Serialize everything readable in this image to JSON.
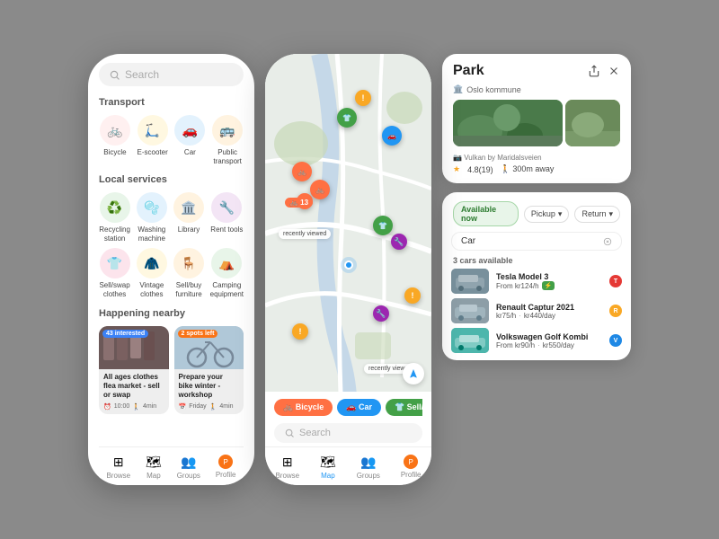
{
  "left_phone": {
    "search_placeholder": "Search",
    "transport_title": "Transport",
    "transport_items": [
      {
        "label": "Bicycle",
        "icon": "🚲",
        "bg": "#fff0f0",
        "color": "#e53935"
      },
      {
        "label": "E-scooter",
        "icon": "🛴",
        "bg": "#fff8e1",
        "color": "#f9a825"
      },
      {
        "label": "Car",
        "icon": "🚗",
        "bg": "#e3f2fd",
        "color": "#1e88e5"
      },
      {
        "label": "Public transport",
        "icon": "🚌",
        "bg": "#fff3e0",
        "color": "#ef6c00"
      }
    ],
    "services_title": "Local services",
    "service_items": [
      {
        "label": "Recycling station",
        "icon": "♻️",
        "bg": "#e8f5e9",
        "color": "#43a047"
      },
      {
        "label": "Washing machine",
        "icon": "🫧",
        "bg": "#e3f2fd",
        "color": "#1e88e5"
      },
      {
        "label": "Library",
        "icon": "🏛️",
        "bg": "#fff3e0",
        "color": "#ef6c00"
      },
      {
        "label": "Rent tools",
        "icon": "🔧",
        "bg": "#f3e5f5",
        "color": "#8e24aa"
      },
      {
        "label": "Sell/swap clothes",
        "icon": "👕",
        "bg": "#fce4ec",
        "color": "#e91e63"
      },
      {
        "label": "Vintage clothes",
        "icon": "🧥",
        "bg": "#fff8e1",
        "color": "#f9a825"
      },
      {
        "label": "Sell/buy furniture",
        "icon": "🪑",
        "bg": "#fff3e0",
        "color": "#ef6c00"
      },
      {
        "label": "Camping equipment",
        "icon": "⛺",
        "bg": "#e8f5e9",
        "color": "#43a047"
      }
    ],
    "happening_title": "Happening nearby",
    "events": [
      {
        "badge": "43 interested",
        "badge_type": "blue",
        "title": "All ages clothes flea market - sell or swap",
        "time": "10:00",
        "distance": "4min"
      },
      {
        "badge": "2 spots left",
        "badge_type": "orange",
        "title": "Prepare your bike winter - workshop",
        "day": "Friday",
        "distance": "4min"
      }
    ],
    "nav": [
      {
        "label": "Browse",
        "icon": "⊞",
        "active": false
      },
      {
        "label": "Map",
        "icon": "🗺",
        "active": false
      },
      {
        "label": "Groups",
        "icon": "👥",
        "active": false
      },
      {
        "label": "Profile",
        "icon": "👤",
        "active": false
      }
    ]
  },
  "center_phone": {
    "filter_pills": [
      "🚲 Bicycle",
      "🚗 Car",
      "👕 Sell/swap clothe…"
    ],
    "search_placeholder": "Search",
    "nav": [
      {
        "label": "Browse",
        "icon": "⊞"
      },
      {
        "label": "Map",
        "icon": "🗺"
      },
      {
        "label": "Groups",
        "icon": "👥"
      },
      {
        "label": "Profile",
        "icon": "👤"
      }
    ]
  },
  "park_panel": {
    "title": "Park",
    "subtitle": "Oslo kommune",
    "credit": "Vulkan by Maridalsveien",
    "rating": "4.8",
    "review_count": "19",
    "distance": "300m away"
  },
  "car_panel": {
    "available_label": "Available now",
    "pickup_label": "Pickup",
    "return_label": "Return",
    "search_value": "Car",
    "cars_count": "3 cars available",
    "cars": [
      {
        "name": "Tesla Model 3",
        "price": "From kr124/h",
        "ev": true,
        "brand_color": "#e53935",
        "brand_letter": "T"
      },
      {
        "name": "Renault Captur 2021",
        "price": "kr75/h",
        "price2": "kr440/day",
        "ev": false,
        "brand_color": "#f9a825",
        "brand_letter": "R"
      },
      {
        "name": "Volkswagen Golf Kombi",
        "price": "From kr90/h",
        "price2": "kr550/day",
        "ev": false,
        "brand_color": "#1e88e5",
        "brand_letter": "V"
      }
    ]
  }
}
